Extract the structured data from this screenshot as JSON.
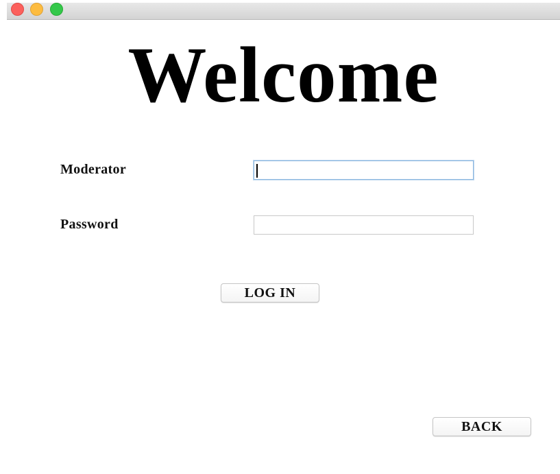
{
  "window": {
    "traffic_lights": [
      "close",
      "minimize",
      "zoom"
    ],
    "colors": {
      "close": "#fc605c",
      "minimize": "#fdbc40",
      "zoom": "#34c84a"
    }
  },
  "heading": "Welcome",
  "form": {
    "moderator_label": "Moderator",
    "moderator_value": "",
    "password_label": "Password",
    "password_value": ""
  },
  "buttons": {
    "login_label": "LOG IN",
    "back_label": "BACK"
  }
}
